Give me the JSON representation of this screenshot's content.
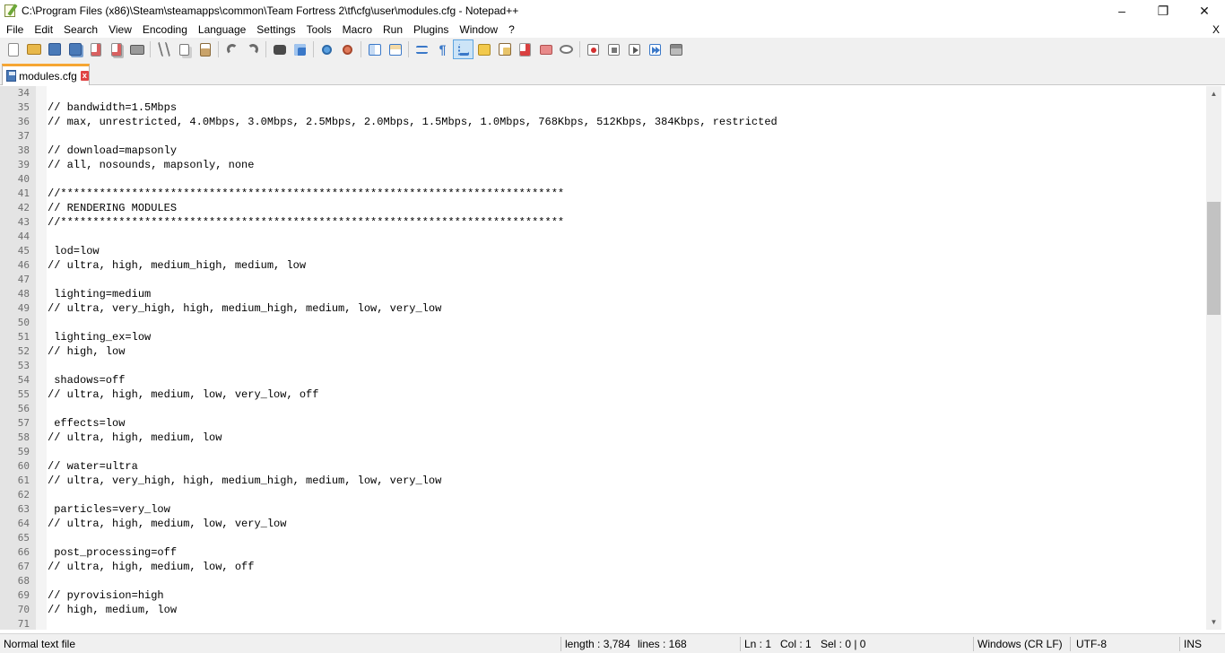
{
  "window": {
    "title": "C:\\Program Files (x86)\\Steam\\steamapps\\common\\Team Fortress 2\\tf\\cfg\\user\\modules.cfg - Notepad++",
    "minimize": "–",
    "restore": "❐",
    "close": "✕"
  },
  "menu": {
    "items": [
      "File",
      "Edit",
      "Search",
      "View",
      "Encoding",
      "Language",
      "Settings",
      "Tools",
      "Macro",
      "Run",
      "Plugins",
      "Window",
      "?"
    ],
    "close_doc": "X"
  },
  "toolbar": {
    "icons": [
      "new-file-icon",
      "open-file-icon",
      "save-icon",
      "save-all-icon",
      "close-icon",
      "close-all-icon",
      "print-icon",
      "cut-icon",
      "copy-icon",
      "paste-icon",
      "undo-icon",
      "redo-icon",
      "find-icon",
      "replace-icon",
      "zoom-in-icon",
      "zoom-out-icon",
      "sync-vertical-icon",
      "sync-horizontal-icon",
      "word-wrap-icon",
      "show-all-chars-icon",
      "indent-guide-icon",
      "language-udl-icon",
      "document-map-icon",
      "function-list-icon",
      "folder-workspace-icon",
      "monitoring-icon",
      "record-macro-icon",
      "stop-macro-icon",
      "play-macro-icon",
      "run-macro-multiple-icon",
      "save-macro-icon"
    ],
    "colors": {
      "new": "#ffffff",
      "open": "#e8b84a",
      "save": "#4a7ab8",
      "close": "#d86060",
      "red": "#d32f2f",
      "blue": "#3a78c8",
      "green": "#4caf50",
      "grey": "#8a8a8a"
    }
  },
  "tab": {
    "label": "modules.cfg",
    "close": "x"
  },
  "editor": {
    "lines": [
      {
        "n": "34",
        "t": ""
      },
      {
        "n": "35",
        "t": "// bandwidth=1.5Mbps"
      },
      {
        "n": "36",
        "t": "// max, unrestricted, 4.0Mbps, 3.0Mbps, 2.5Mbps, 2.0Mbps, 1.5Mbps, 1.0Mbps, 768Kbps, 512Kbps, 384Kbps, restricted"
      },
      {
        "n": "37",
        "t": ""
      },
      {
        "n": "38",
        "t": "// download=mapsonly"
      },
      {
        "n": "39",
        "t": "// all, nosounds, mapsonly, none"
      },
      {
        "n": "40",
        "t": ""
      },
      {
        "n": "41",
        "t": "//******************************************************************************"
      },
      {
        "n": "42",
        "t": "// RENDERING MODULES"
      },
      {
        "n": "43",
        "t": "//******************************************************************************"
      },
      {
        "n": "44",
        "t": ""
      },
      {
        "n": "45",
        "t": " lod=low"
      },
      {
        "n": "46",
        "t": "// ultra, high, medium_high, medium, low"
      },
      {
        "n": "47",
        "t": ""
      },
      {
        "n": "48",
        "t": " lighting=medium"
      },
      {
        "n": "49",
        "t": "// ultra, very_high, high, medium_high, medium, low, very_low"
      },
      {
        "n": "50",
        "t": ""
      },
      {
        "n": "51",
        "t": " lighting_ex=low"
      },
      {
        "n": "52",
        "t": "// high, low"
      },
      {
        "n": "53",
        "t": ""
      },
      {
        "n": "54",
        "t": " shadows=off"
      },
      {
        "n": "55",
        "t": "// ultra, high, medium, low, very_low, off"
      },
      {
        "n": "56",
        "t": ""
      },
      {
        "n": "57",
        "t": " effects=low"
      },
      {
        "n": "58",
        "t": "// ultra, high, medium, low"
      },
      {
        "n": "59",
        "t": ""
      },
      {
        "n": "60",
        "t": "// water=ultra"
      },
      {
        "n": "61",
        "t": "// ultra, very_high, high, medium_high, medium, low, very_low"
      },
      {
        "n": "62",
        "t": ""
      },
      {
        "n": "63",
        "t": " particles=very_low"
      },
      {
        "n": "64",
        "t": "// ultra, high, medium, low, very_low"
      },
      {
        "n": "65",
        "t": ""
      },
      {
        "n": "66",
        "t": " post_processing=off"
      },
      {
        "n": "67",
        "t": "// ultra, high, medium, low, off"
      },
      {
        "n": "68",
        "t": ""
      },
      {
        "n": "69",
        "t": "// pyrovision=high"
      },
      {
        "n": "70",
        "t": "// high, medium, low"
      },
      {
        "n": "71",
        "t": ""
      }
    ]
  },
  "scrollbar": {
    "up": "▲",
    "down": "▼"
  },
  "status": {
    "type": "Normal text file",
    "length": "length : 3,784",
    "lines": "lines : 168",
    "ln": "Ln : 1",
    "col": "Col : 1",
    "sel": "Sel : 0 | 0",
    "eol": "Windows (CR LF)",
    "encoding": "UTF-8",
    "mode": "INS"
  }
}
